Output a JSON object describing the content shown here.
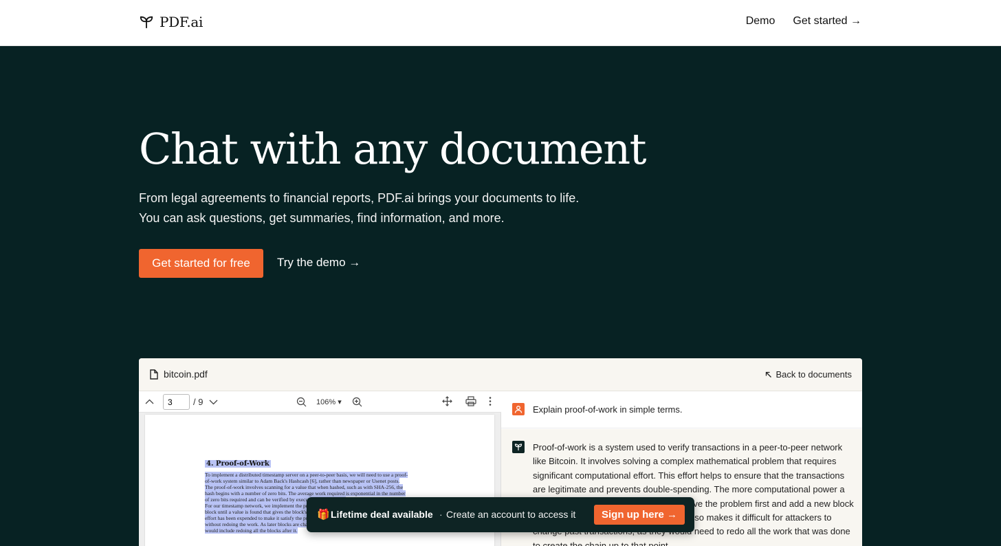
{
  "brand": {
    "name": "PDF.ai"
  },
  "nav": {
    "demo": "Demo",
    "get_started": "Get started →"
  },
  "hero": {
    "title": "Chat with any document",
    "subtitle_line1": "From legal agreements to financial reports, PDF.ai brings your documents to life.",
    "subtitle_line2": "You can ask questions, get summaries, find information, and more.",
    "cta_primary": "Get started for free",
    "cta_secondary": "Try the demo →"
  },
  "app": {
    "file_name": "bitcoin.pdf",
    "back_link": "Back to documents",
    "viewer": {
      "page_value": "3",
      "page_total": "/ 9",
      "zoom": "106% ▾"
    },
    "pdf": {
      "heading": "4.    Proof-of-Work",
      "lines": [
        "To implement a distributed timestamp server on a peer-to-peer basis, we will need to use a proof-",
        "of-work system similar to Adam Back's Hashcash [6], rather than newspaper or Usenet posts.",
        "The proof-of-work involves scanning for a value that when hashed, such as with SHA-256, the",
        "hash begins with a number of zero bits.  The average work required is exponential in the number",
        "of zero bits required and can be verified by executing a single hash.",
        "     For our timestamp network, we implement the proof-of-work by incrementing a nonce in the",
        "block until a value is found that gives the block's hash the required zero bits.  Once the CPU",
        "effort has been expended to make it satisfy the proof-of-work, the block cannot be changed",
        "without redoing the work.  As later blocks are chained after it, the work to change the block",
        "would include redoing all the blocks after it."
      ]
    },
    "chat": {
      "question": "Explain proof-of-work in simple terms.",
      "answer": "Proof-of-work is a system used to verify transactions in a peer-to-peer network like Bitcoin. It involves solving a complex mathematical problem that requires significant computational effort. This effort helps to ensure that the transactions are legitimate and prevents double-spending. The more computational power a participant has, the more likely it is to solve the problem first and add a new block to the chain. The proof-of-work system also makes it difficult for attackers to change past transactions, as they would need to redo all the work that was done to create the chain up to that point."
    }
  },
  "banner": {
    "gift_emoji": "🎁",
    "title": "Lifetime deal available",
    "separator": "·",
    "description": "Create an account to access it",
    "button": "Sign up here →"
  },
  "colors": {
    "background": "#072223",
    "accent": "#f0652f",
    "highlight": "#b9c3f5"
  },
  "icons": [
    "sprout-logo-icon",
    "file-icon",
    "arrow-up-left-icon",
    "chevron-up-icon",
    "chevron-down-icon",
    "zoom-out-icon",
    "zoom-in-icon",
    "move-icon",
    "print-icon",
    "more-vertical-icon",
    "user-icon",
    "gift-icon"
  ]
}
